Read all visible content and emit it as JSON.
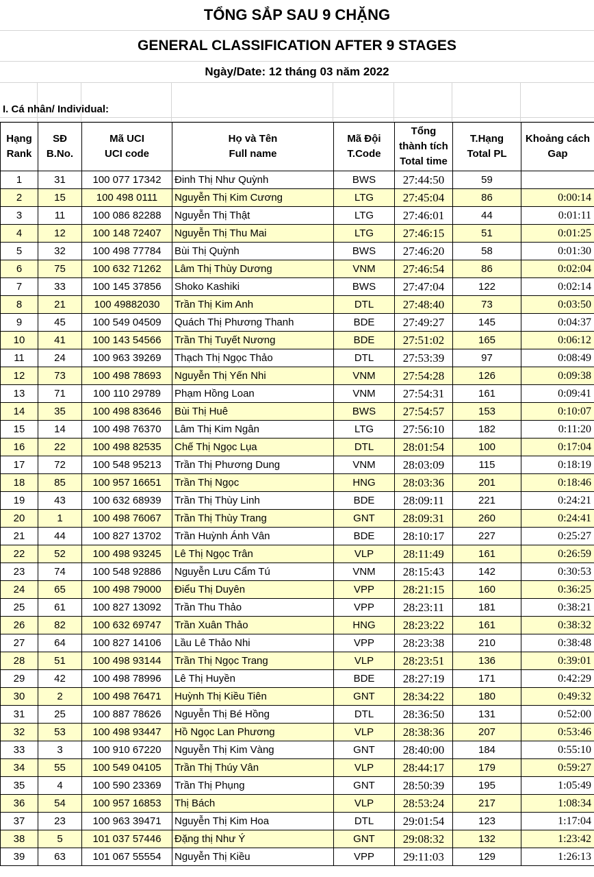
{
  "title_vi": "TỔNG SẮP SAU 9 CHẶNG",
  "title_en": "GENERAL CLASSIFICATION AFTER 9 STAGES",
  "date_line": "Ngày/Date: 12 tháng 03 năm 2022",
  "section_label": "I. Cá nhân/ Individual:",
  "headers": {
    "rank_vi": "Hạng",
    "rank_en": "Rank",
    "bno_vi": "SĐ",
    "bno_en": "B.No.",
    "uci_vi": "Mã UCI",
    "uci_en": "UCI code",
    "name_vi": "Họ và Tên",
    "name_en": "Full name",
    "team_vi": "Mã Đội",
    "team_en": "T.Code",
    "time_1": "Tổng",
    "time_2": "thành tích",
    "time_3": "Total time",
    "pl_vi": "T.Hạng",
    "pl_en": "Total PL",
    "gap_vi": "Khoảng cách",
    "gap_en": "Gap"
  },
  "rows": [
    [
      "1",
      "31",
      "100 077 17342",
      "Đinh Thị Như Quỳnh",
      "BWS",
      "27:44:50",
      "59",
      ""
    ],
    [
      "2",
      "15",
      "100 498 0111",
      "Nguyễn Thị Kim Cương",
      "LTG",
      "27:45:04",
      "86",
      "0:00:14"
    ],
    [
      "3",
      "11",
      "100 086 82288",
      "Nguyễn Thị Thật",
      "LTG",
      "27:46:01",
      "44",
      "0:01:11"
    ],
    [
      "4",
      "12",
      "100 148 72407",
      "Nguyễn Thị Thu Mai",
      "LTG",
      "27:46:15",
      "51",
      "0:01:25"
    ],
    [
      "5",
      "32",
      "100 498 77784",
      "Bùi Thị Quỳnh",
      "BWS",
      "27:46:20",
      "58",
      "0:01:30"
    ],
    [
      "6",
      "75",
      "100 632 71262",
      "Lâm Thị Thùy Dương",
      "VNM",
      "27:46:54",
      "86",
      "0:02:04"
    ],
    [
      "7",
      "33",
      "100 145 37856",
      "Shoko Kashiki",
      "BWS",
      "27:47:04",
      "122",
      "0:02:14"
    ],
    [
      "8",
      "21",
      "100 49882030",
      "Trần Thị Kim Anh",
      "DTL",
      "27:48:40",
      "73",
      "0:03:50"
    ],
    [
      "9",
      "45",
      "100 549 04509",
      "Quách Thị Phương Thanh",
      "BDE",
      "27:49:27",
      "145",
      "0:04:37"
    ],
    [
      "10",
      "41",
      "100 143 54566",
      "Trần Thị Tuyết Nương",
      "BDE",
      "27:51:02",
      "165",
      "0:06:12"
    ],
    [
      "11",
      "24",
      "100 963 39269",
      "Thạch Thị Ngọc Thảo",
      "DTL",
      "27:53:39",
      "97",
      "0:08:49"
    ],
    [
      "12",
      "73",
      "100 498 78693",
      "Nguyễn Thị Yến Nhi",
      "VNM",
      "27:54:28",
      "126",
      "0:09:38"
    ],
    [
      "13",
      "71",
      "100 110 29789",
      "Phạm Hồng Loan",
      "VNM",
      "27:54:31",
      "161",
      "0:09:41"
    ],
    [
      "14",
      "35",
      "100 498 83646",
      "Bùi Thị Huê",
      "BWS",
      "27:54:57",
      "153",
      "0:10:07"
    ],
    [
      "15",
      "14",
      "100 498 76370",
      "Lâm Thị Kim Ngân",
      "LTG",
      "27:56:10",
      "182",
      "0:11:20"
    ],
    [
      "16",
      "22",
      "100 498 82535",
      "Chế Thị Ngọc Lụa",
      "DTL",
      "28:01:54",
      "100",
      "0:17:04"
    ],
    [
      "17",
      "72",
      "100 548 95213",
      "Trần Thị Phương Dung",
      "VNM",
      "28:03:09",
      "115",
      "0:18:19"
    ],
    [
      "18",
      "85",
      "100 957 16651",
      "Trần Thị Ngọc",
      "HNG",
      "28:03:36",
      "201",
      "0:18:46"
    ],
    [
      "19",
      "43",
      "100 632 68939",
      "Trần Thị Thùy Linh",
      "BDE",
      "28:09:11",
      "221",
      "0:24:21"
    ],
    [
      "20",
      "1",
      "100 498 76067",
      "Trần Thị Thùy Trang",
      "GNT",
      "28:09:31",
      "260",
      "0:24:41"
    ],
    [
      "21",
      "44",
      "100 827 13702",
      "Trần Huỳnh Ánh Vân",
      "BDE",
      "28:10:17",
      "227",
      "0:25:27"
    ],
    [
      "22",
      "52",
      "100 498 93245",
      "Lê Thị Ngọc Trân",
      "VLP",
      "28:11:49",
      "161",
      "0:26:59"
    ],
    [
      "23",
      "74",
      "100 548 92886",
      "Nguyễn Lưu Cẩm Tú",
      "VNM",
      "28:15:43",
      "142",
      "0:30:53"
    ],
    [
      "24",
      "65",
      "100 498 79000",
      "Điểu Thị Duyên",
      "VPP",
      "28:21:15",
      "160",
      "0:36:25"
    ],
    [
      "25",
      "61",
      "100 827 13092",
      "Trần Thu Thảo",
      "VPP",
      "28:23:11",
      "181",
      "0:38:21"
    ],
    [
      "26",
      "82",
      "100 632 69747",
      "Trần Xuân Thảo",
      "HNG",
      "28:23:22",
      "161",
      "0:38:32"
    ],
    [
      "27",
      "64",
      "100 827 14106",
      "Lầu Lê Thảo Nhi",
      "VPP",
      "28:23:38",
      "210",
      "0:38:48"
    ],
    [
      "28",
      "51",
      "100 498 93144",
      "Trần Thị Ngọc Trang",
      "VLP",
      "28:23:51",
      "136",
      "0:39:01"
    ],
    [
      "29",
      "42",
      "100 498 78996",
      "Lê Thị Huyền",
      "BDE",
      "28:27:19",
      "171",
      "0:42:29"
    ],
    [
      "30",
      "2",
      "100 498 76471",
      "Huỳnh Thị Kiều Tiên",
      "GNT",
      "28:34:22",
      "180",
      "0:49:32"
    ],
    [
      "31",
      "25",
      "100 887 78626",
      "Nguyễn Thị Bé Hồng",
      "DTL",
      "28:36:50",
      "131",
      "0:52:00"
    ],
    [
      "32",
      "53",
      "100 498 93447",
      "Hồ Ngọc Lan Phương",
      "VLP",
      "28:38:36",
      "207",
      "0:53:46"
    ],
    [
      "33",
      "3",
      "100 910 67220",
      "Nguyễn Thị Kim Vàng",
      "GNT",
      "28:40:00",
      "184",
      "0:55:10"
    ],
    [
      "34",
      "55",
      "100 549 04105",
      "Trần Thị Thúy Vân",
      "VLP",
      "28:44:17",
      "179",
      "0:59:27"
    ],
    [
      "35",
      "4",
      "100 590 23369",
      "Trần Thị Phụng",
      "GNT",
      "28:50:39",
      "195",
      "1:05:49"
    ],
    [
      "36",
      "54",
      "100 957 16853",
      "Thị Bách",
      "VLP",
      "28:53:24",
      "217",
      "1:08:34"
    ],
    [
      "37",
      "23",
      "100 963 39471",
      "Nguyễn Thị Kim Hoa",
      "DTL",
      "29:01:54",
      "123",
      "1:17:04"
    ],
    [
      "38",
      "5",
      "101 037 57446",
      "Đặng thị Như Ý",
      "GNT",
      "29:08:32",
      "132",
      "1:23:42"
    ],
    [
      "39",
      "63",
      "101 067 55554",
      "Nguyễn Thị Kiều",
      "VPP",
      "29:11:03",
      "129",
      "1:26:13"
    ]
  ]
}
